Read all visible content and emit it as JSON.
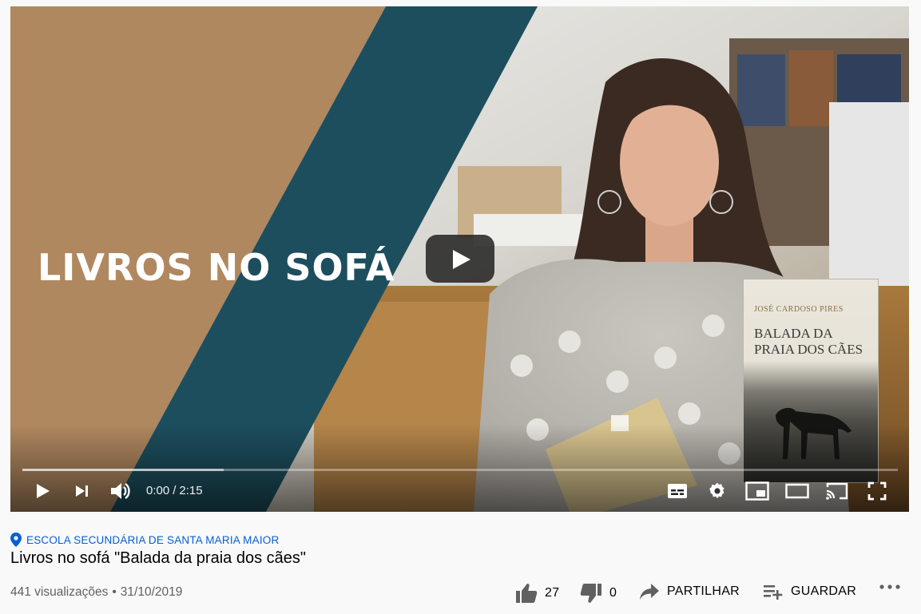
{
  "player": {
    "thumbnail_title": "LIVROS NO SOFÁ",
    "book": {
      "author": "JOSÉ CARDOSO PIRES",
      "title": "BALADA DA PRAIA DOS CÃES"
    },
    "current_time": "0:00",
    "separator": "/",
    "duration": "2:15",
    "loaded_fraction": 0.23,
    "colors": {
      "tan": "#b08860",
      "teal": "#1d4e5e"
    }
  },
  "video": {
    "location": "ESCOLA SECUNDÁRIA DE SANTA MARIA MAIOR",
    "title": "Livros no sofá \"Balada da praia dos cães\"",
    "views": "441 visualizações",
    "bullet": "•",
    "date": "31/10/2019"
  },
  "actions": {
    "likes": "27",
    "dislikes": "0",
    "share_label": "PARTILHAR",
    "save_label": "GUARDAR"
  },
  "icons": {
    "play": "play-icon",
    "next": "next-icon",
    "volume": "volume-icon",
    "subtitles": "subtitles-icon",
    "settings": "gear-icon",
    "miniplayer": "miniplayer-icon",
    "theater": "theater-icon",
    "cast": "cast-icon",
    "fullscreen": "fullscreen-icon",
    "location": "location-pin-icon",
    "like": "thumbs-up-icon",
    "dislike": "thumbs-down-icon",
    "share": "share-arrow-icon",
    "save": "playlist-add-icon",
    "more": "more-horizontal-icon"
  }
}
